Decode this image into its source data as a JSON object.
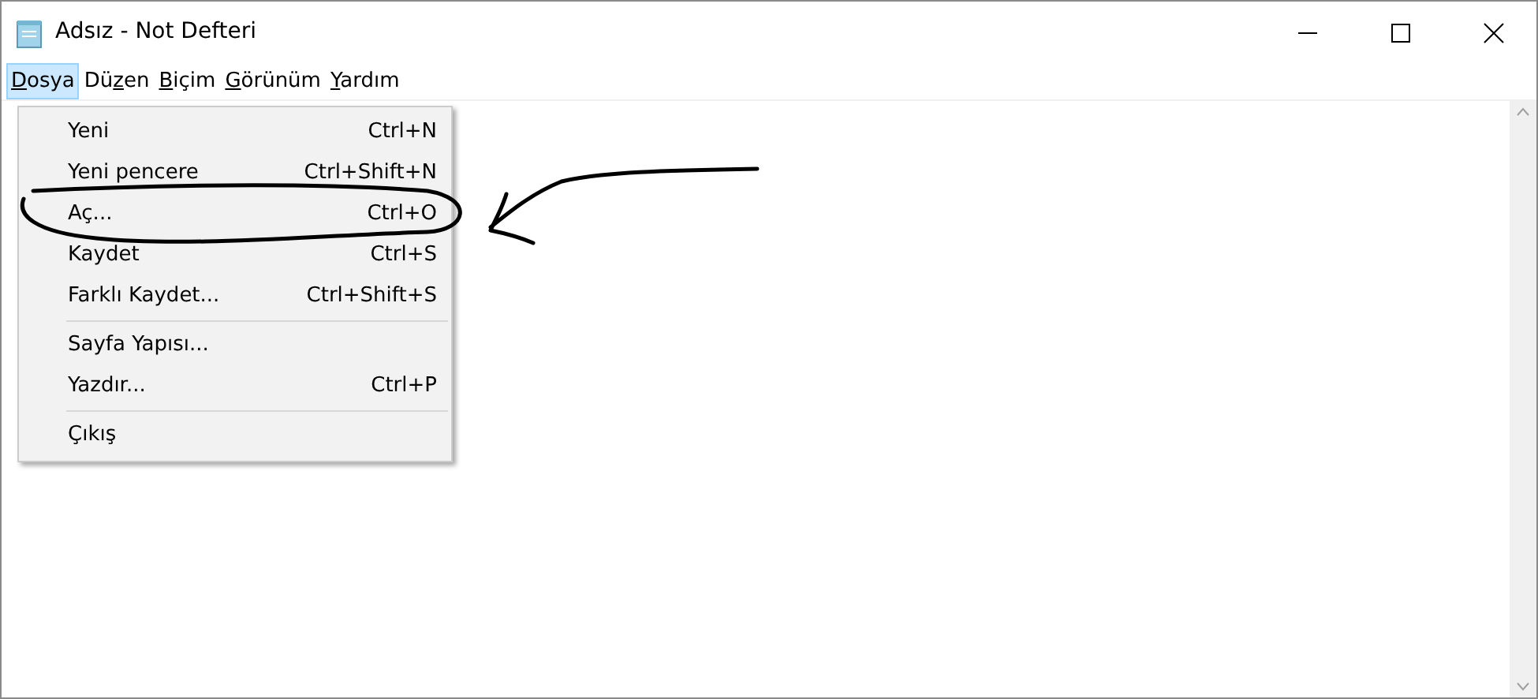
{
  "window": {
    "title": "Adsız - Not Defteri"
  },
  "menubar": [
    {
      "key": "D",
      "after": "osya",
      "selected": true
    },
    {
      "before": "Dü",
      "key": "z",
      "after": "en",
      "selected": false
    },
    {
      "key": "B",
      "after": "içim",
      "selected": false
    },
    {
      "key": "G",
      "after": "örünüm",
      "selected": false
    },
    {
      "key": "Y",
      "after": "ardım",
      "selected": false
    }
  ],
  "menu": [
    {
      "label": "Yeni",
      "shortcut": "Ctrl+N",
      "separator_after": false
    },
    {
      "label": "Yeni pencere",
      "shortcut": "Ctrl+Shift+N",
      "separator_after": false
    },
    {
      "label": "Aç...",
      "shortcut": "Ctrl+O",
      "separator_after": false
    },
    {
      "label": "Kaydet",
      "shortcut": "Ctrl+S",
      "separator_after": false
    },
    {
      "label": "Farklı Kaydet...",
      "shortcut": "Ctrl+Shift+S",
      "separator_after": true
    },
    {
      "label": "Sayfa Yapısı...",
      "separator_after": false
    },
    {
      "label": "Yazdır...",
      "shortcut": "Ctrl+P",
      "separator_after": true
    },
    {
      "label": "Çıkış",
      "separator_after": false
    }
  ],
  "annotations": {
    "loop_drawn": true,
    "arrow_drawn": true
  }
}
